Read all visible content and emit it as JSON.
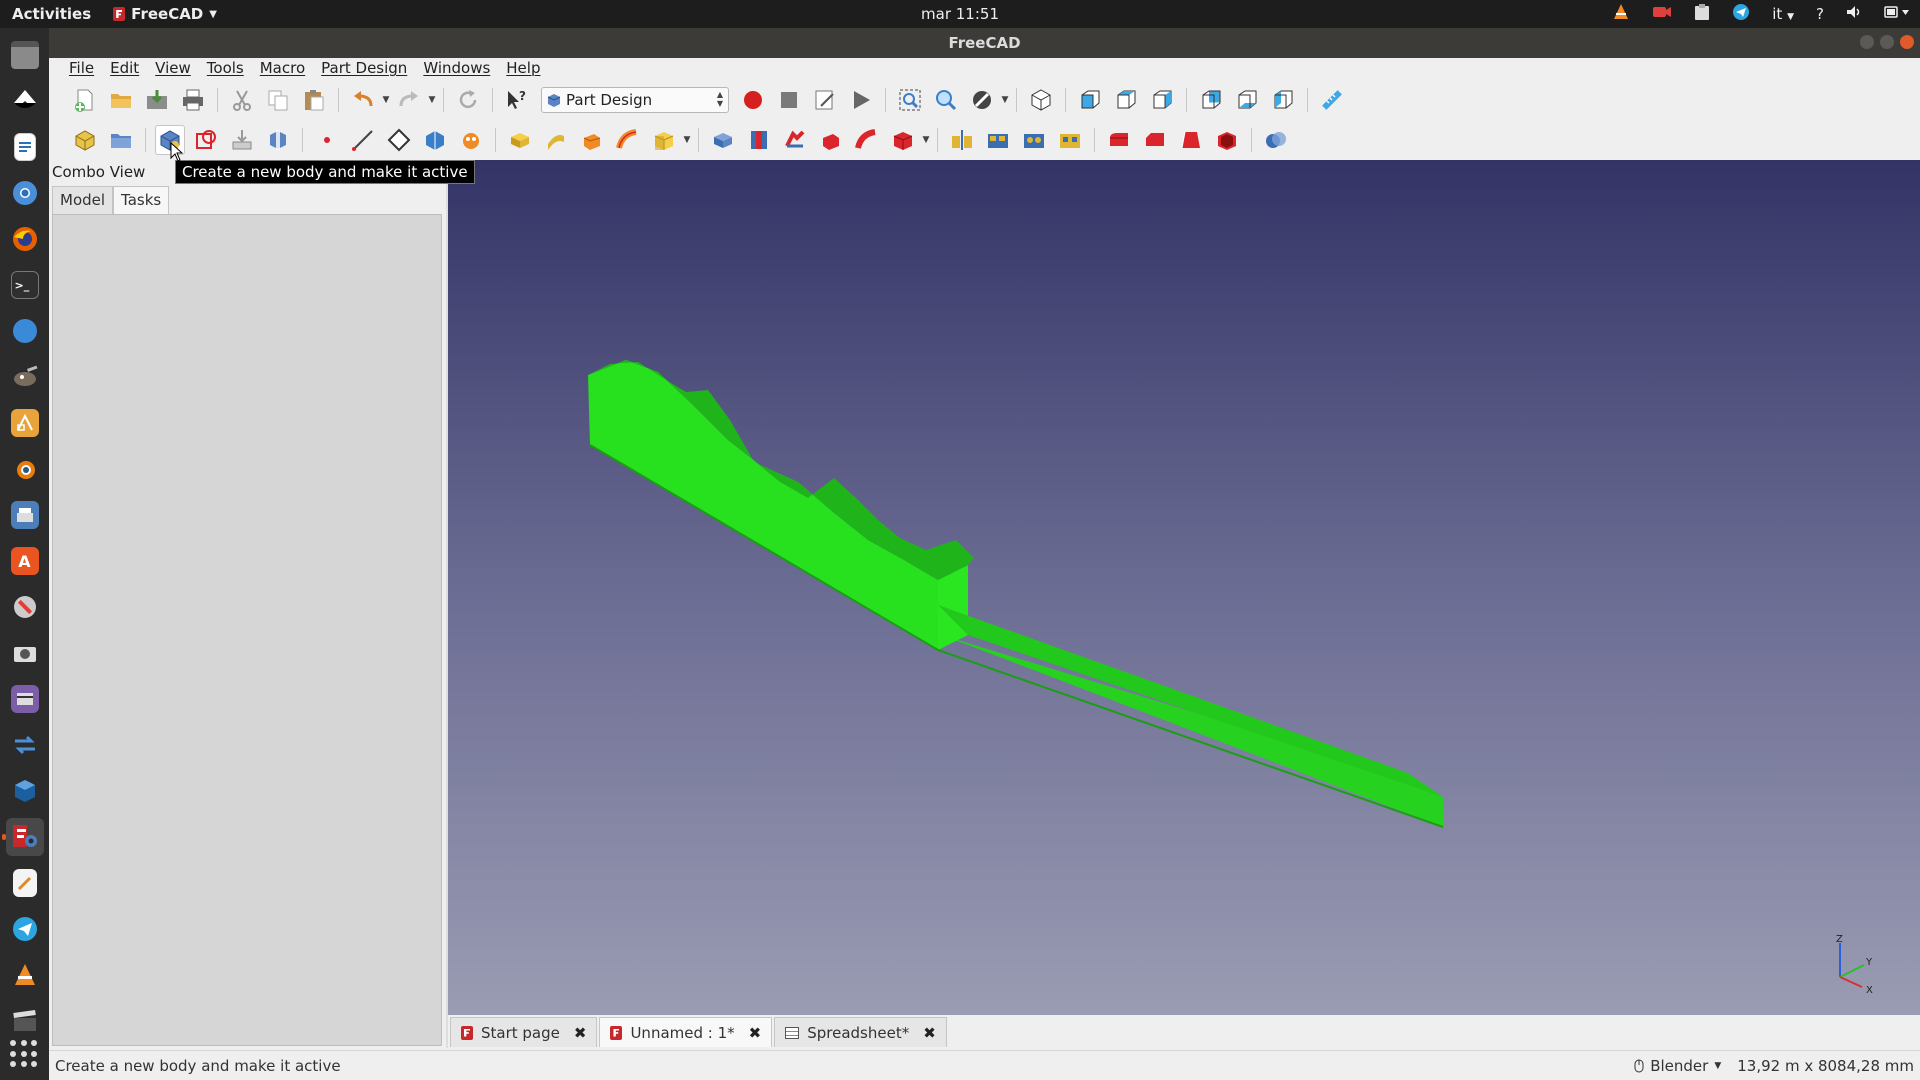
{
  "topbar": {
    "activities": "Activities",
    "app_name": "FreeCAD",
    "clock": "mar 11:51",
    "keyboard_layout": "it",
    "help": "?"
  },
  "dock": {
    "apps": [
      "files-icon",
      "inkscape-icon",
      "writer-icon",
      "chromium-icon",
      "firefox-icon",
      "terminal-icon",
      "safari-like-icon",
      "gimp-icon",
      "draw-icon",
      "blender-icon",
      "scanner-icon",
      "software-center-icon",
      "tools-icon",
      "screenshot-icon",
      "video-editor-icon",
      "flow-icon",
      "virtualbox-icon",
      "freecad-icon",
      "text-editor-icon",
      "telegram-icon",
      "vlc-icon",
      "clapper-icon"
    ]
  },
  "window": {
    "title": "FreeCAD"
  },
  "menubar": {
    "items": [
      "File",
      "Edit",
      "View",
      "Tools",
      "Macro",
      "Part Design",
      "Windows",
      "Help"
    ]
  },
  "toolbar": {
    "workbench": "Part Design"
  },
  "combo": {
    "title": "Combo View",
    "tabs": [
      "Model",
      "Tasks"
    ],
    "active_tab": "Tasks"
  },
  "tooltip": {
    "text": "Create a new body and make it active"
  },
  "doc_tabs": [
    {
      "label": "Start page"
    },
    {
      "label": "Unnamed : 1*"
    },
    {
      "label": "Spreadsheet*"
    }
  ],
  "status": {
    "message": "Create a new body and make it active",
    "navigation": "Blender",
    "dimensions": "13,92 m x 8084,28 mm"
  },
  "colors": {
    "viewport_top": "#333366",
    "viewport_bottom": "#9a9cb3",
    "model_green": "#22e11e",
    "accent": "#e95420"
  }
}
